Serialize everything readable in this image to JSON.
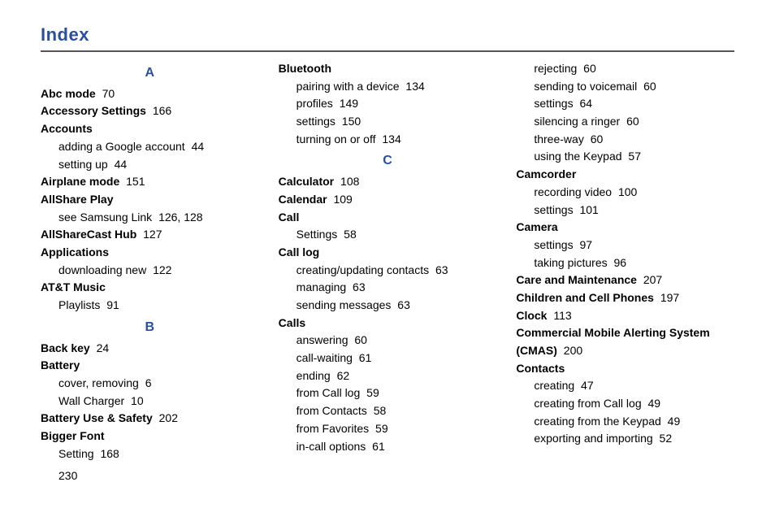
{
  "title": "Index",
  "page_number": "230",
  "columns": [
    [
      {
        "type": "letter",
        "text": "A",
        "name": "section-a"
      },
      {
        "type": "bold",
        "label": "Abc mode",
        "page": "70",
        "name": "abc-mode"
      },
      {
        "type": "bold",
        "label": "Accessory Settings",
        "page": "166",
        "name": "accessory-settings"
      },
      {
        "type": "bold",
        "label": "Accounts",
        "page": "",
        "name": "accounts"
      },
      {
        "type": "sub",
        "label": "adding a Google account",
        "page": "44",
        "name": "accounts-add-google"
      },
      {
        "type": "sub",
        "label": "setting up",
        "page": "44",
        "name": "accounts-setting-up"
      },
      {
        "type": "bold",
        "label": "Airplane mode",
        "page": "151",
        "name": "airplane-mode"
      },
      {
        "type": "bold",
        "label": "AllShare Play",
        "page": "",
        "name": "allshare-play"
      },
      {
        "type": "sub",
        "label": "see Samsung Link",
        "page": "126, 128",
        "name": "allshare-see-samsung-link"
      },
      {
        "type": "bold",
        "label": "AllShareCast Hub",
        "page": "127",
        "name": "allsharecast-hub"
      },
      {
        "type": "bold",
        "label": "Applications",
        "page": "",
        "name": "applications"
      },
      {
        "type": "sub",
        "label": "downloading new",
        "page": "122",
        "name": "applications-downloading-new"
      },
      {
        "type": "bold",
        "label": "AT&T Music",
        "page": "",
        "name": "att-music"
      },
      {
        "type": "sub",
        "label": "Playlists",
        "page": "91",
        "name": "att-music-playlists"
      },
      {
        "type": "letter",
        "text": "B",
        "name": "section-b"
      },
      {
        "type": "bold",
        "label": "Back key",
        "page": "24",
        "name": "back-key"
      },
      {
        "type": "bold",
        "label": "Battery",
        "page": "",
        "name": "battery"
      },
      {
        "type": "sub",
        "label": "cover, removing",
        "page": "6",
        "name": "battery-cover-removing"
      },
      {
        "type": "sub",
        "label": "Wall Charger",
        "page": "10",
        "name": "battery-wall-charger"
      },
      {
        "type": "bold",
        "label": "Battery Use & Safety",
        "page": "202",
        "name": "battery-use-safety"
      },
      {
        "type": "bold",
        "label": "Bigger Font",
        "page": "",
        "name": "bigger-font"
      },
      {
        "type": "sub",
        "label": "Setting",
        "page": "168",
        "name": "bigger-font-setting"
      }
    ],
    [
      {
        "type": "bold",
        "label": "Bluetooth",
        "page": "",
        "name": "bluetooth"
      },
      {
        "type": "sub",
        "label": "pairing with a device",
        "page": "134",
        "name": "bluetooth-pairing"
      },
      {
        "type": "sub",
        "label": "profiles",
        "page": "149",
        "name": "bluetooth-profiles"
      },
      {
        "type": "sub",
        "label": "settings",
        "page": "150",
        "name": "bluetooth-settings"
      },
      {
        "type": "sub",
        "label": "turning on or off",
        "page": "134",
        "name": "bluetooth-toggle"
      },
      {
        "type": "letter",
        "text": "C",
        "name": "section-c"
      },
      {
        "type": "bold",
        "label": "Calculator",
        "page": "108",
        "name": "calculator"
      },
      {
        "type": "bold",
        "label": "Calendar",
        "page": "109",
        "name": "calendar"
      },
      {
        "type": "bold",
        "label": "Call",
        "page": "",
        "name": "call"
      },
      {
        "type": "sub",
        "label": "Settings",
        "page": "58",
        "name": "call-settings"
      },
      {
        "type": "bold",
        "label": "Call log",
        "page": "",
        "name": "call-log"
      },
      {
        "type": "sub",
        "label": "creating/updating contacts",
        "page": "63",
        "name": "call-log-contacts"
      },
      {
        "type": "sub",
        "label": "managing",
        "page": "63",
        "name": "call-log-managing"
      },
      {
        "type": "sub",
        "label": "sending messages",
        "page": "63",
        "name": "call-log-messages"
      },
      {
        "type": "bold",
        "label": "Calls",
        "page": "",
        "name": "calls"
      },
      {
        "type": "sub",
        "label": "answering",
        "page": "60",
        "name": "calls-answering"
      },
      {
        "type": "sub",
        "label": "call-waiting",
        "page": "61",
        "name": "calls-call-waiting"
      },
      {
        "type": "sub",
        "label": "ending",
        "page": "62",
        "name": "calls-ending"
      },
      {
        "type": "sub",
        "label": "from Call log",
        "page": "59",
        "name": "calls-from-call-log"
      },
      {
        "type": "sub",
        "label": "from Contacts",
        "page": "58",
        "name": "calls-from-contacts"
      },
      {
        "type": "sub",
        "label": "from Favorites",
        "page": "59",
        "name": "calls-from-favorites"
      },
      {
        "type": "sub",
        "label": "in-call options",
        "page": "61",
        "name": "calls-in-call-options"
      }
    ],
    [
      {
        "type": "sub",
        "label": "rejecting",
        "page": "60",
        "name": "calls-rejecting"
      },
      {
        "type": "sub",
        "label": "sending to voicemail",
        "page": "60",
        "name": "calls-voicemail"
      },
      {
        "type": "sub",
        "label": "settings",
        "page": "64",
        "name": "calls-settings"
      },
      {
        "type": "sub",
        "label": "silencing a ringer",
        "page": "60",
        "name": "calls-silencing-ringer"
      },
      {
        "type": "sub",
        "label": "three-way",
        "page": "60",
        "name": "calls-three-way"
      },
      {
        "type": "sub",
        "label": "using the Keypad",
        "page": "57",
        "name": "calls-keypad"
      },
      {
        "type": "bold",
        "label": "Camcorder",
        "page": "",
        "name": "camcorder"
      },
      {
        "type": "sub",
        "label": "recording video",
        "page": "100",
        "name": "camcorder-recording"
      },
      {
        "type": "sub",
        "label": "settings",
        "page": "101",
        "name": "camcorder-settings"
      },
      {
        "type": "bold",
        "label": "Camera",
        "page": "",
        "name": "camera"
      },
      {
        "type": "sub",
        "label": "settings",
        "page": "97",
        "name": "camera-settings"
      },
      {
        "type": "sub",
        "label": "taking pictures",
        "page": "96",
        "name": "camera-taking-pictures"
      },
      {
        "type": "bold",
        "label": "Care and Maintenance",
        "page": "207",
        "name": "care-maintenance"
      },
      {
        "type": "bold",
        "label": "Children and Cell Phones",
        "page": "197",
        "name": "children-cell-phones"
      },
      {
        "type": "bold",
        "label": "Clock",
        "page": "113",
        "name": "clock"
      },
      {
        "type": "bold",
        "label": "Commercial Mobile Alerting System (CMAS)",
        "page": "200",
        "name": "cmas"
      },
      {
        "type": "bold",
        "label": "Contacts",
        "page": "",
        "name": "contacts"
      },
      {
        "type": "sub",
        "label": "creating",
        "page": "47",
        "name": "contacts-creating"
      },
      {
        "type": "sub",
        "label": "creating from Call log",
        "page": "49",
        "name": "contacts-from-call-log"
      },
      {
        "type": "sub",
        "label": "creating from the Keypad",
        "page": "49",
        "name": "contacts-from-keypad"
      },
      {
        "type": "sub",
        "label": "exporting and importing",
        "page": "52",
        "name": "contacts-export-import"
      }
    ]
  ]
}
